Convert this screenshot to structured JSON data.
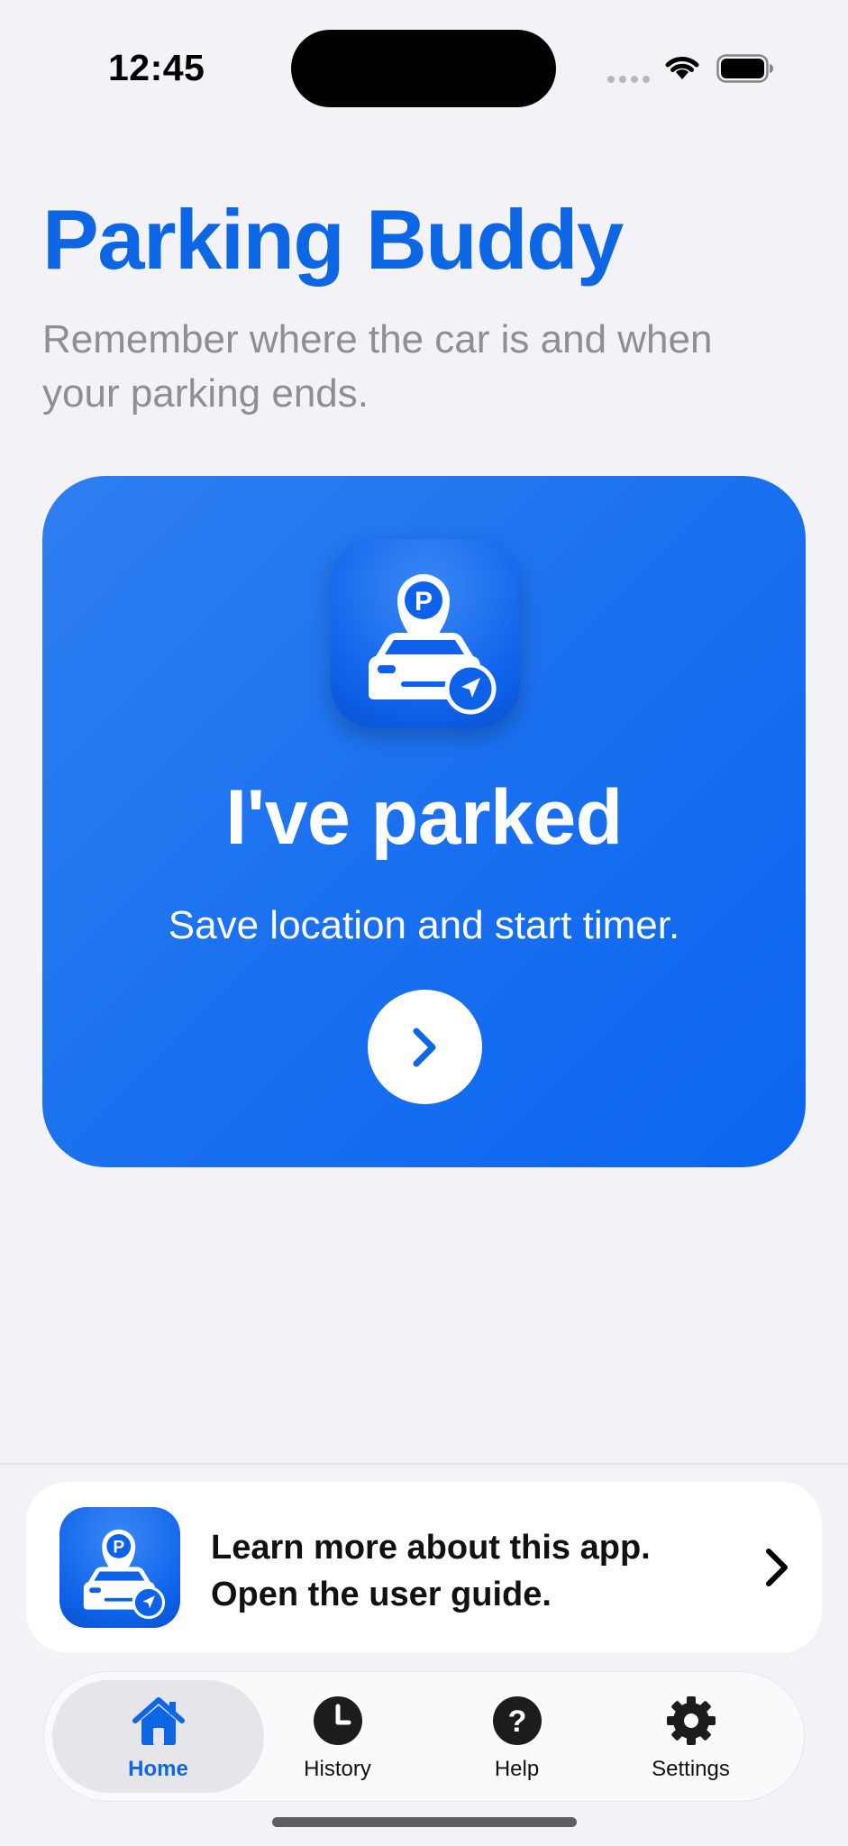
{
  "status_bar": {
    "time": "12:45"
  },
  "header": {
    "title": "Parking Buddy",
    "subtitle": "Remember where the car is and when your parking ends."
  },
  "parked_card": {
    "title": "I've parked",
    "subtitle": "Save location and start timer.",
    "icon": "parking-car-location-icon",
    "button_icon": "chevron-right-icon"
  },
  "guide_banner": {
    "line1": "Learn more about this app.",
    "line2": "Open the user guide.",
    "icon": "parking-car-location-icon"
  },
  "tabs": [
    {
      "label": "Home",
      "icon": "house-icon",
      "active": true
    },
    {
      "label": "History",
      "icon": "clock-icon",
      "active": false
    },
    {
      "label": "Help",
      "icon": "question-icon",
      "active": false
    },
    {
      "label": "Settings",
      "icon": "gear-icon",
      "active": false
    }
  ],
  "colors": {
    "accent": "#0d66e4",
    "card_gradient_start": "#2f7ff0",
    "card_gradient_end": "#0b66f0",
    "background": "#f2f2f7",
    "secondary_text": "#8e8e93"
  }
}
